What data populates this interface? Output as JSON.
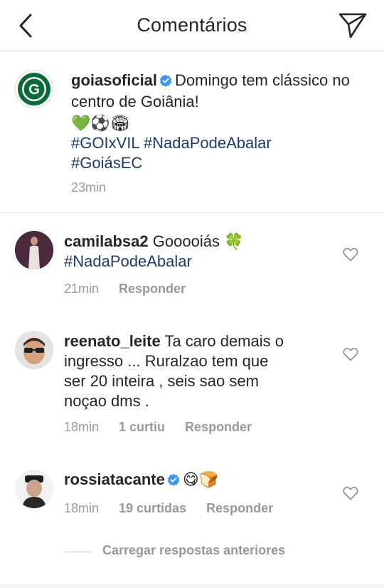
{
  "header": {
    "title": "Comentários",
    "back_icon": "chevron-left-icon",
    "send_icon": "paper-plane-icon"
  },
  "caption": {
    "username": "goiasoficial",
    "verified": true,
    "text": "Domingo tem clássico no centro de Goiânia!",
    "emojis": "💚⚽🏟",
    "hashtags_line1": "#GOIxVIL #NadaPodeAbalar",
    "hashtags_line2": "#GoiásEC",
    "time": "23min"
  },
  "comments": [
    {
      "username": "camilabsa2",
      "text": "Gooooiás 🍀",
      "hashtag": "#NadaPodeAbalar",
      "time": "21min",
      "reply": "Responder"
    },
    {
      "username": "reenato_leite",
      "text_line1": "Ta caro demais o",
      "text_line2": "ingresso ... Ruralzao tem que",
      "text_line3": "ser 20 inteira , seis sao sem",
      "text_line4": "noçao dms .",
      "time": "18min",
      "likes": "1 curtiu",
      "reply": "Responder"
    },
    {
      "username": "rossiatacante",
      "verified": true,
      "text": "😋🍞",
      "time": "18min",
      "likes": "19 curtidas",
      "reply": "Responder"
    }
  ],
  "load_more": "Carregar respostas anteriores",
  "colors": {
    "hashtag": "#1d3b6a",
    "meta": "#999999",
    "verified": "#3897f0",
    "goias_green": "#0a6b3a"
  }
}
